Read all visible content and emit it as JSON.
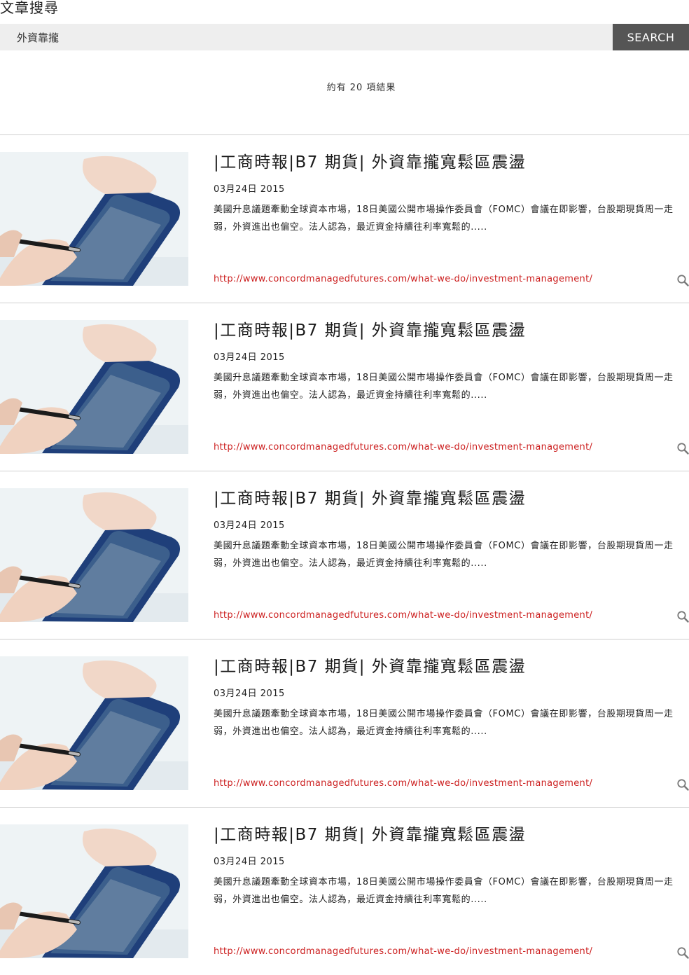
{
  "page": {
    "title": "文章搜尋"
  },
  "search": {
    "value": "外資靠攏",
    "button_label": "SEARCH"
  },
  "results": {
    "count_text": "約有 20 項結果",
    "items": [
      {
        "title": "|工商時報|B7 期貨| 外資靠攏寬鬆區震盪",
        "date": "03月24日 2015",
        "summary": "美國升息議題牽動全球資本市場，18日美國公開市場操作委員會（FOMC）會議在即影響，台股期現貨周一走弱，外資進出也偏空。法人認為，最近資金持續往利率寬鬆的.....",
        "url": "http://www.concordmanagedfutures.com/what-we-do/investment-management/"
      },
      {
        "title": "|工商時報|B7 期貨| 外資靠攏寬鬆區震盪",
        "date": "03月24日 2015",
        "summary": "美國升息議題牽動全球資本市場，18日美國公開市場操作委員會（FOMC）會議在即影響，台股期現貨周一走弱，外資進出也偏空。法人認為，最近資金持續往利率寬鬆的.....",
        "url": "http://www.concordmanagedfutures.com/what-we-do/investment-management/"
      },
      {
        "title": "|工商時報|B7 期貨| 外資靠攏寬鬆區震盪",
        "date": "03月24日 2015",
        "summary": "美國升息議題牽動全球資本市場，18日美國公開市場操作委員會（FOMC）會議在即影響，台股期現貨周一走弱，外資進出也偏空。法人認為，最近資金持續往利率寬鬆的.....",
        "url": "http://www.concordmanagedfutures.com/what-we-do/investment-management/"
      },
      {
        "title": "|工商時報|B7 期貨| 外資靠攏寬鬆區震盪",
        "date": "03月24日 2015",
        "summary": "美國升息議題牽動全球資本市場，18日美國公開市場操作委員會（FOMC）會議在即影響，台股期現貨周一走弱，外資進出也偏空。法人認為，最近資金持續往利率寬鬆的.....",
        "url": "http://www.concordmanagedfutures.com/what-we-do/investment-management/"
      },
      {
        "title": "|工商時報|B7 期貨| 外資靠攏寬鬆區震盪",
        "date": "03月24日 2015",
        "summary": "美國升息議題牽動全球資本市場，18日美國公開市場操作委員會（FOMC）會議在即影響，台股期現貨周一走弱，外資進出也偏空。法人認為，最近資金持續往利率寬鬆的.....",
        "url": "http://www.concordmanagedfutures.com/what-we-do/investment-management/"
      }
    ]
  },
  "icons": {
    "thumbnail": "tablet-photo",
    "item_action": "search-icon"
  },
  "colors": {
    "link": "#cc1f1f",
    "search_button": "#555555",
    "search_field": "#eeeeee",
    "tablet_body": "#1f3f7a"
  }
}
